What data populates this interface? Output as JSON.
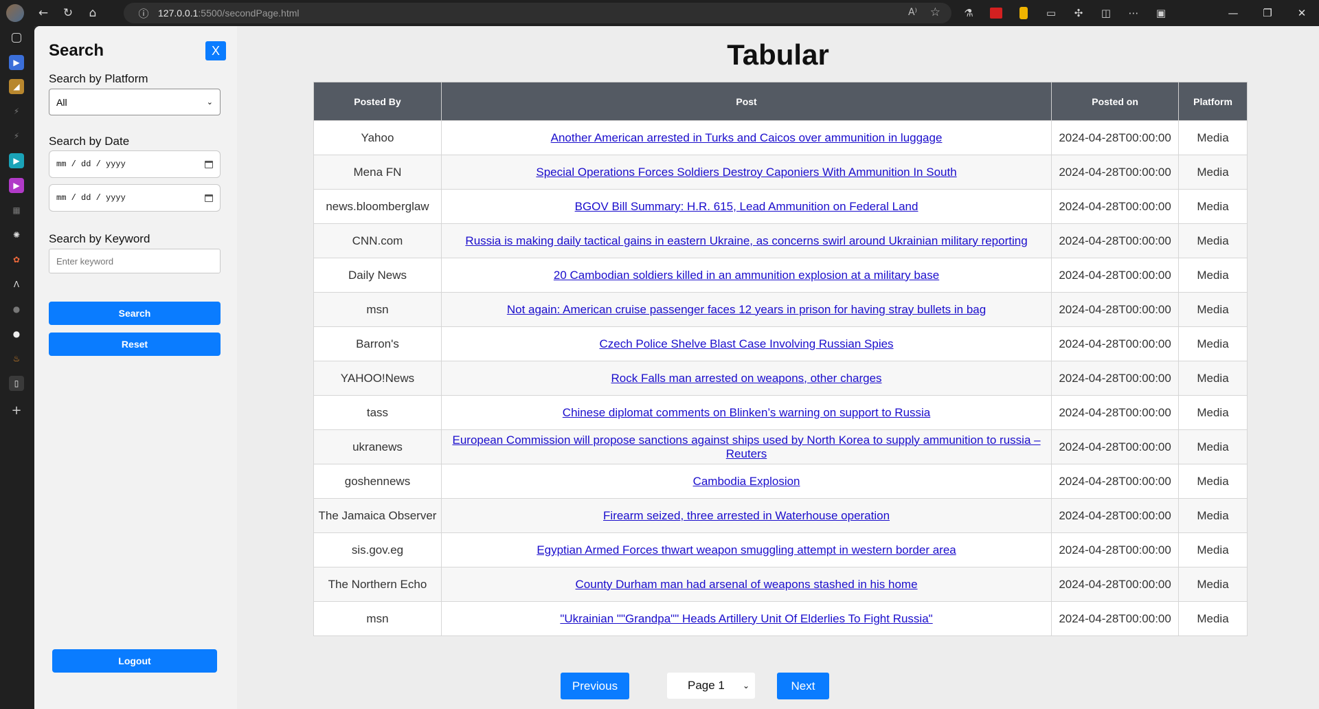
{
  "browser": {
    "url_host": "127.0.0.1",
    "url_rest": ":5500/secondPage.html"
  },
  "sidebar": {
    "title": "Search",
    "close_label": "X",
    "platform_label": "Search by Platform",
    "platform_value": "All",
    "date_label": "Search by Date",
    "date_from": "mm / dd / yyyy",
    "date_to": "mm / dd / yyyy",
    "keyword_label": "Search by Keyword",
    "keyword_placeholder": "Enter keyword",
    "search_label": "Search",
    "reset_label": "Reset",
    "logout_label": "Logout"
  },
  "main": {
    "title": "Tabular",
    "columns": [
      "Posted By",
      "Post",
      "Posted on",
      "Platform"
    ],
    "rows": [
      {
        "by": "Yahoo",
        "post": "Another American arrested in Turks and Caicos over ammunition in luggage",
        "date": "2024-04-28T00:00:00",
        "platform": "Media"
      },
      {
        "by": "Mena FN",
        "post": "Special Operations Forces Soldiers Destroy Caponiers With Ammunition In South",
        "date": "2024-04-28T00:00:00",
        "platform": "Media"
      },
      {
        "by": "news.bloomberglaw",
        "post": "BGOV Bill Summary: H.R. 615, Lead Ammunition on Federal Land",
        "date": "2024-04-28T00:00:00",
        "platform": "Media"
      },
      {
        "by": "CNN.com",
        "post": "Russia is making daily tactical gains in eastern Ukraine, as concerns swirl around Ukrainian military reporting",
        "date": "2024-04-28T00:00:00",
        "platform": "Media"
      },
      {
        "by": "Daily News",
        "post": "20 Cambodian soldiers killed in an ammunition explosion at a military base",
        "date": "2024-04-28T00:00:00",
        "platform": "Media"
      },
      {
        "by": "msn",
        "post": "Not again: American cruise passenger faces 12 years in prison for having stray bullets in bag",
        "date": "2024-04-28T00:00:00",
        "platform": "Media"
      },
      {
        "by": "Barron's",
        "post": "Czech Police Shelve Blast Case Involving Russian Spies",
        "date": "2024-04-28T00:00:00",
        "platform": "Media"
      },
      {
        "by": "YAHOO!News",
        "post": "Rock Falls man arrested on weapons, other charges",
        "date": "2024-04-28T00:00:00",
        "platform": "Media"
      },
      {
        "by": "tass",
        "post": "Chinese diplomat comments on Blinken’s warning on support to Russia",
        "date": "2024-04-28T00:00:00",
        "platform": "Media"
      },
      {
        "by": "ukranews",
        "post": "European Commission will propose sanctions against ships used by North Korea to supply ammunition to russia – Reuters",
        "date": "2024-04-28T00:00:00",
        "platform": "Media"
      },
      {
        "by": "goshennews",
        "post": "Cambodia Explosion",
        "date": "2024-04-28T00:00:00",
        "platform": "Media"
      },
      {
        "by": "The Jamaica Observer",
        "post": "Firearm seized, three arrested in Waterhouse operation",
        "date": "2024-04-28T00:00:00",
        "platform": "Media"
      },
      {
        "by": "sis.gov.eg",
        "post": "Egyptian Armed Forces thwart weapon smuggling attempt in western border area",
        "date": "2024-04-28T00:00:00",
        "platform": "Media"
      },
      {
        "by": "The Northern Echo",
        "post": "County Durham man had arsenal of weapons stashed in his home",
        "date": "2024-04-28T00:00:00",
        "platform": "Media"
      },
      {
        "by": "msn",
        "post": "\"Ukrainian \"\"Grandpa\"\" Heads Artillery Unit Of Elderlies To Fight Russia\"",
        "date": "2024-04-28T00:00:00",
        "platform": "Media"
      }
    ]
  },
  "pager": {
    "prev_label": "Previous",
    "page_value": "Page 1",
    "next_label": "Next"
  },
  "colors": {
    "accent": "#0a7cff",
    "header_bg": "#545a63",
    "link": "#1a0dcc"
  }
}
